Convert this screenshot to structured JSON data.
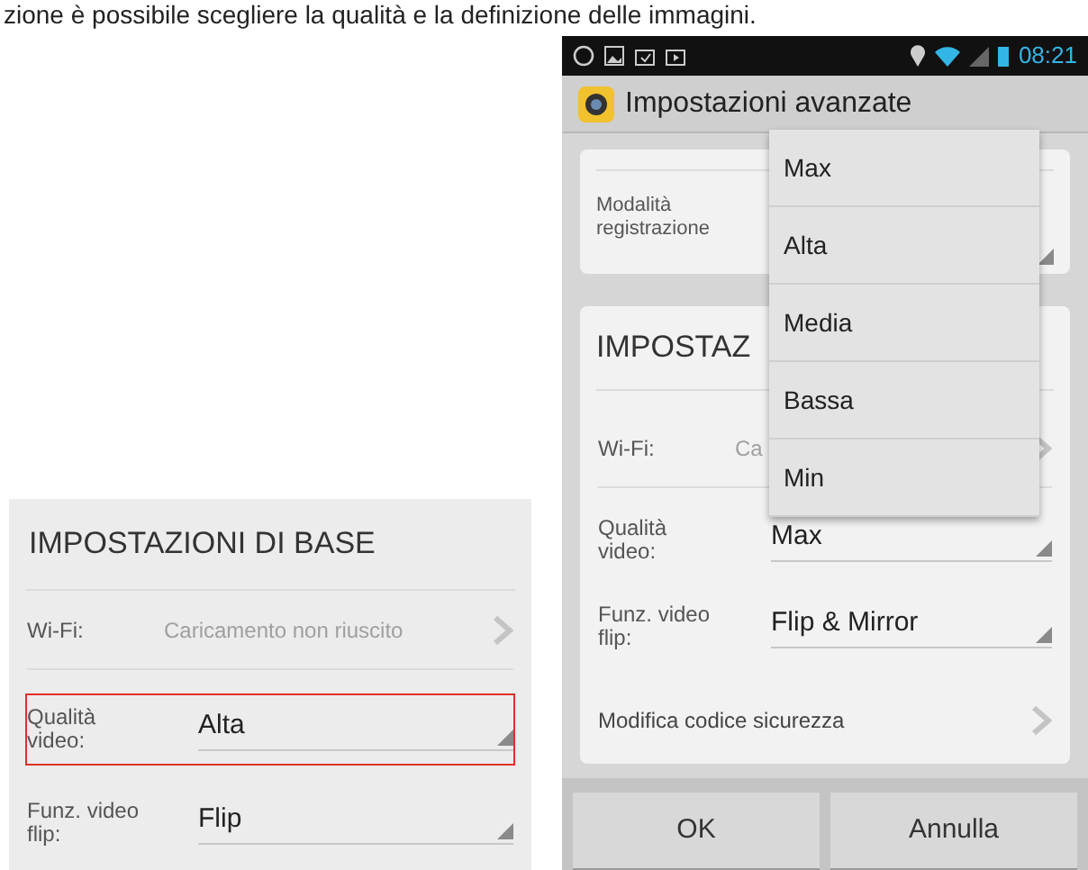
{
  "caption": "zione è possibile scegliere la qualità e la definizione delle immagini.",
  "left_screenshot": {
    "section_title": "IMPOSTAZIONI DI BASE",
    "rows": [
      {
        "kind": "link",
        "label": "Wi-Fi:",
        "value": "Caricamento non riuscito",
        "highlighted": false
      },
      {
        "kind": "select",
        "label": "Qualità video:",
        "value": "Alta",
        "highlighted": true
      },
      {
        "kind": "select",
        "label": "Funz. video flip:",
        "value": "Flip",
        "highlighted": false
      }
    ]
  },
  "phone": {
    "status_bar": {
      "time": "08:21"
    },
    "title": "Impostazioni avanzate",
    "recording_card": {
      "label": "Modalità registrazione"
    },
    "basic_card": {
      "section_title": "IMPOSTAZ",
      "rows": [
        {
          "kind": "link",
          "label": "Wi-Fi:",
          "value": "Ca"
        },
        {
          "kind": "select",
          "label": "Qualità video:",
          "value": "Max"
        },
        {
          "kind": "select",
          "label": "Funz. video flip:",
          "value": "Flip & Mirror"
        },
        {
          "kind": "action",
          "label": "Modifica codice sicurezza"
        }
      ]
    },
    "dropdown_options": [
      "Max",
      "Alta",
      "Media",
      "Bassa",
      "Min"
    ],
    "buttons": [
      "OK",
      "Annulla"
    ]
  }
}
